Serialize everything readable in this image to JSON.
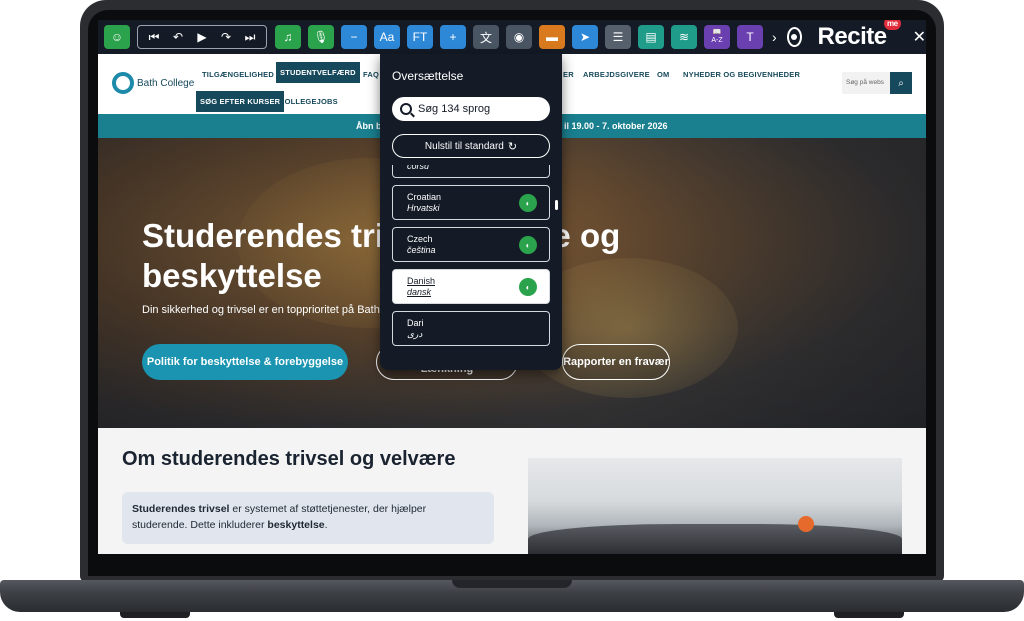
{
  "toolbar": {
    "brand": "Recite",
    "brand_badge": "me",
    "font_btn": "Aa",
    "ft_btn": "FT",
    "dictionary_sub": "A-Z",
    "close": "✕"
  },
  "site": {
    "logo_text": "Bath College",
    "nav": [
      "TILGÆNGELIGHED",
      "STUDENTVELFÆRD",
      "FAQ",
      "ER",
      "ARBEJDSGIVERE",
      "OM",
      "NYHEDER OG BEGIVENHEDER",
      "SØG EFTER KURSER",
      "COLLEGEJOBS"
    ],
    "search_placeholder": "Søg på webs"
  },
  "banner": {
    "left": "Åbn b",
    "right": "il 19.00 - 7. oktober 2026"
  },
  "hero": {
    "title_line1": "Studerendes triv",
    "title_line1_end": "e og",
    "title_line2": "beskyttelse",
    "subtitle": "Din sikkerhed og trivsel er en topprioritet på Bath",
    "btn_primary": "Politik for beskyttelse & forebyggelse",
    "btn_middle": "Lænkning",
    "btn_right": "Rapporter en fravær"
  },
  "intro": {
    "title": "Om studerendes trivsel og velvære",
    "box_bold1": "Studerendes trivsel",
    "box_text1": " er systemet af støttetjenester, der hjælper studerende. Dette inkluderer ",
    "box_bold2": "beskyttelse",
    "box_text2": "."
  },
  "translate_panel": {
    "title": "Oversættelse",
    "search_placeholder": "Søg 134 sprog",
    "reset_label": "Nulstil til standard",
    "languages": [
      {
        "name": "",
        "native": "corsu",
        "selected": false
      },
      {
        "name": "Croatian",
        "native": "Hrvatski",
        "selected": false
      },
      {
        "name": "Czech",
        "native": "čeština",
        "selected": false
      },
      {
        "name": "Danish",
        "native": "dansk",
        "selected": true
      },
      {
        "name": "Dari",
        "native": "دری",
        "selected": false
      }
    ]
  },
  "colors": {
    "toolbar_bg": "#141b26",
    "brand_teal": "#1a7f8e",
    "brand_navy": "#17495c",
    "button_teal": "#1a94b0",
    "accent_green": "#2ba24c"
  }
}
